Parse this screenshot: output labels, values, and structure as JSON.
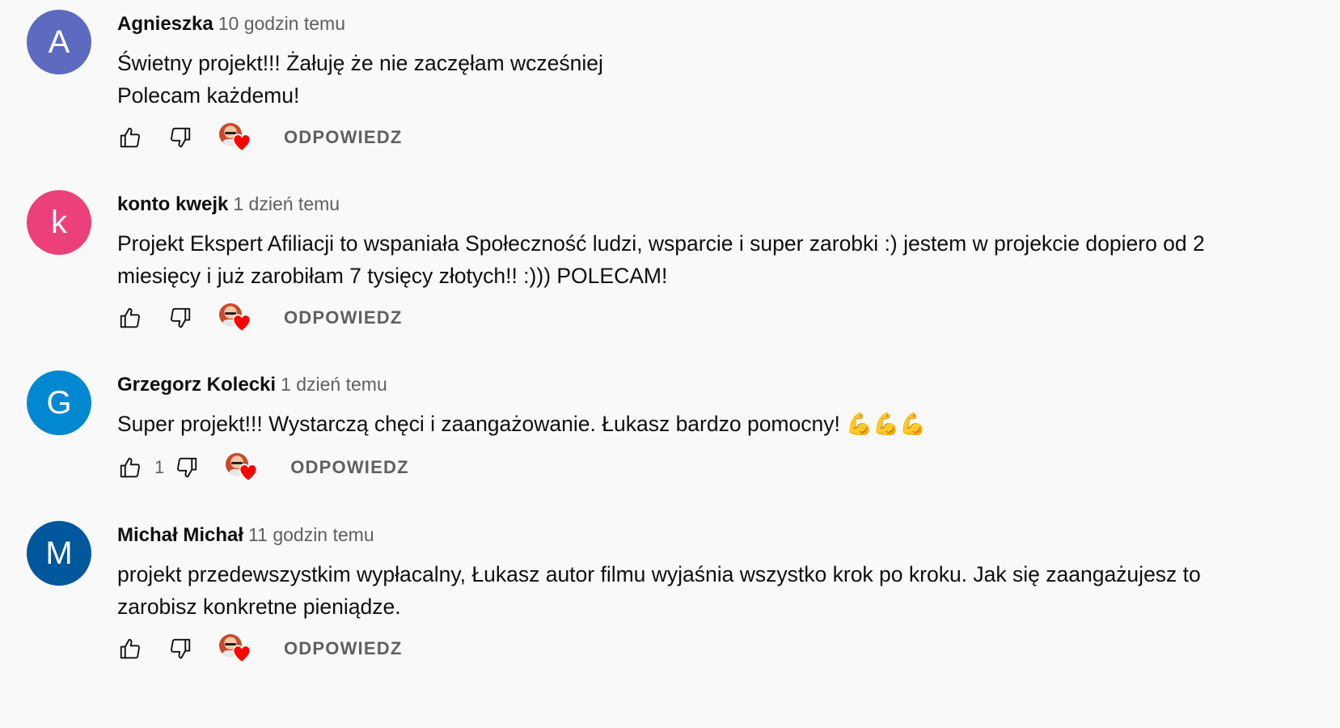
{
  "comments": [
    {
      "author": "Agnieszka",
      "time": "10 godzin temu",
      "avatar_letter": "A",
      "avatar_color": "#5c6bc0",
      "text": "Świetny projekt!!! Żałuję że nie zaczęłam wcześniej\nPolecam każdemu!",
      "likes": "",
      "reply_label": "ODPOWIEDZ"
    },
    {
      "author": "konto kwejk",
      "time": "1 dzień temu",
      "avatar_letter": "k",
      "avatar_color": "#ec407a",
      "text": "Projekt Ekspert Afiliacji to wspaniała Społeczność ludzi, wsparcie i super zarobki :) jestem w projekcie dopiero od 2 miesięcy i już zarobiłam 7 tysięcy złotych!! :))) POLECAM!",
      "likes": "",
      "reply_label": "ODPOWIEDZ"
    },
    {
      "author": "Grzegorz Kolecki",
      "time": "1 dzień temu",
      "avatar_letter": "G",
      "avatar_color": "#0288d1",
      "text": "Super projekt!!! Wystarczą chęci i zaangażowanie. Łukasz bardzo pomocny! 💪💪💪",
      "likes": "1",
      "reply_label": "ODPOWIEDZ"
    },
    {
      "author": "Michał Michał",
      "time": "11 godzin temu",
      "avatar_letter": "M",
      "avatar_color": "#01579b",
      "text": "projekt przedewszystkim wypłacalny, Łukasz autor filmu wyjaśnia wszystko krok po kroku. Jak się zaangażujesz to zarobisz konkretne pieniądze.",
      "likes": "",
      "reply_label": "ODPOWIEDZ"
    }
  ],
  "icons": {
    "like": "thumbs-up-icon",
    "dislike": "thumbs-down-icon",
    "heart": "creator-heart-icon"
  },
  "colors": {
    "heart": "#ff0000",
    "secondary_text": "#606060"
  }
}
